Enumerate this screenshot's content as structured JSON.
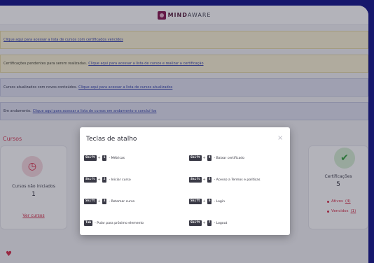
{
  "header": {
    "logo_bold": "MIND",
    "logo_light": "AWARE"
  },
  "banners": [
    {
      "text": "Clique aqui para acessar a lista de cursos com certificados vencidos",
      "link": ""
    },
    {
      "text": "Certificações pendentes para serem realizadas.",
      "link": "Clique aqui para acessar a lista de cursos e realizar a certificação"
    },
    {
      "text": "Cursos atualizados com novos conteúdos.",
      "link": "Clique aqui para acessar a lista de cursos atualizados"
    },
    {
      "text": "Em andamento.",
      "link": "Clique aqui para acessar a lista de cursos em andamento e concluí-los"
    }
  ],
  "section_title": "Cursos",
  "card_left": {
    "icon": "clock-icon",
    "label": "Cursos não iniciados",
    "value": "1",
    "link": "Ver cursos"
  },
  "card_right": {
    "icon": "check-badge-icon",
    "label": "Certificações",
    "value": "5",
    "status": [
      {
        "label": "Ativos",
        "value": "(4)"
      },
      {
        "label": "Vencidos",
        "value": "(1)"
      }
    ]
  },
  "modal": {
    "title": "Teclas de atalho",
    "close_symbol": "×",
    "shortcuts": [
      {
        "keys": [
          "Shift",
          "1"
        ],
        "desc": "- Métricas"
      },
      {
        "keys": [
          "Shift",
          "4"
        ],
        "desc": "- Baixar certificado"
      },
      {
        "keys": [
          "Shift",
          "2"
        ],
        "desc": "- Iniciar curso"
      },
      {
        "keys": [
          "Shift",
          "5"
        ],
        "desc": "- Acesso a Termos e políticas"
      },
      {
        "keys": [
          "Shift",
          "3"
        ],
        "desc": "- Retomar curso"
      },
      {
        "keys": [
          "Shift",
          "6"
        ],
        "desc": "- Login"
      },
      {
        "keys": [
          "Tab"
        ],
        "desc": "- Pular para próximo elemento"
      },
      {
        "keys": [
          "Shift",
          "7"
        ],
        "desc": "- Logout"
      }
    ]
  },
  "colors": {
    "accent": "#d8344e",
    "background": "#181a8c",
    "success": "#3aa443"
  }
}
